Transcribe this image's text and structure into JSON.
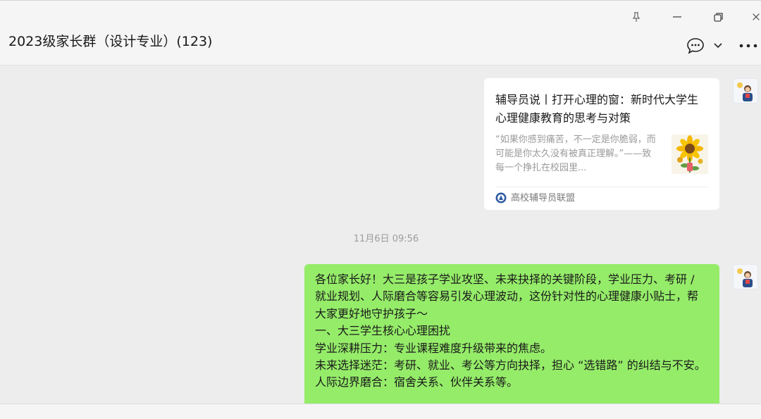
{
  "window": {
    "controls": [
      "pin-icon",
      "minimize-icon",
      "restore-icon",
      "close-icon"
    ]
  },
  "header": {
    "title": "2023级家长群（设计专业）(123)",
    "buttons": [
      "chat-bubble-icon",
      "chevron-down-icon",
      "more-icon"
    ]
  },
  "messages": {
    "link_card": {
      "title": "辅导员说丨打开心理的窗：新时代大学生心理健康教育的思考与对策",
      "description": "“如果你感到痛苦，不一定是你脆弱，而可能是你太久没有被真正理解。”——致每一个挣扎在校园里...",
      "source": "高校辅导员联盟",
      "thumbnail_icon": "sunflower-image"
    },
    "timestamp": "11月6日 09:56",
    "text_message": {
      "lines": [
        "各位家长好！大三是孩子学业攻坚、未来抉择的关键阶段，学业压力、考研 / 就业规划、人际磨合等容易引发心理波动，这份针对性的心理健康小贴士，帮大家更好地守护孩子～",
        "一、大三学生核心心理困扰",
        "学业深耕压力：专业课程难度升级带来的焦虑。",
        "未来选择迷茫：考研、就业、考公等方向抉择，担心 “选错路” 的纠结与不安。",
        "人际边界磨合：宿舍关系、伙伴关系等。"
      ]
    }
  },
  "colors": {
    "bubble_green": "#95ec69",
    "background": "#ededed",
    "card": "#ffffff"
  }
}
